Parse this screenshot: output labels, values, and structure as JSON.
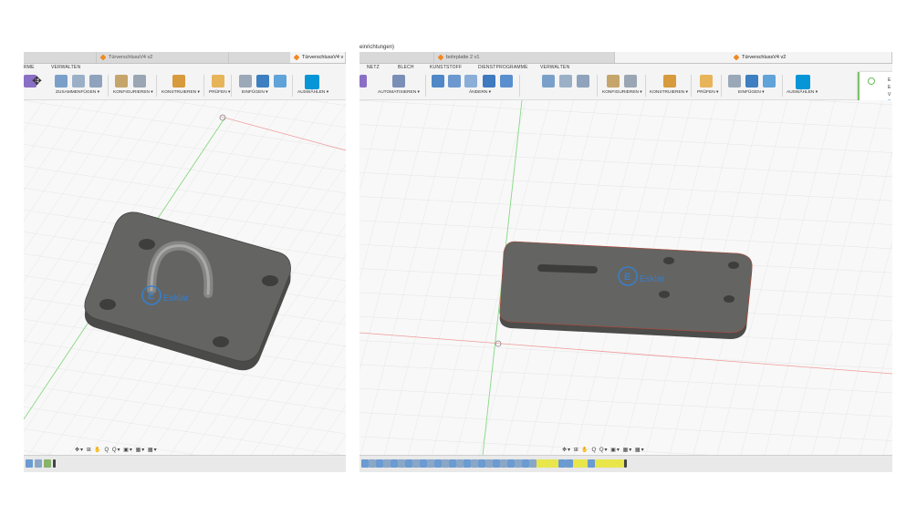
{
  "left": {
    "tabs": {
      "second": "TürverschlussV4 v2",
      "third": "TürverschlussV4 v"
    },
    "menus": {
      "first": "RME",
      "verwalten": "VERWALTEN"
    },
    "groups": {
      "assemble": "ZUSAMMENFÜGEN ▾",
      "configure": "KONFIGURIEREN ▾",
      "construct": "KONSTRUIEREN ▾",
      "inspect": "PRÜFEN ▾",
      "insert": "EINFÜGEN ▾",
      "select": "AUSWÄHLEN ▾"
    },
    "navbar": "✥▾ ⊞ ✋ Q Q▾ ▣▾ ▦▾ ▦▾",
    "logo_text": "Esklar"
  },
  "right": {
    "titlebar": "einrichtungen)",
    "tabs": {
      "second": "bohrplatte 2 v1",
      "third": "TürverschlussV4 v2"
    },
    "menus": {
      "netz": "NETZ",
      "blech": "BLECH",
      "kunststoff": "KUNSTSTOFF",
      "dienstprogramme": "DIENSTPROGRAMME",
      "verwalten": "VERWALTEN"
    },
    "groups": {
      "automate": "AUTOMATISIEREN ▾",
      "modify": "ÄNDERN ▾",
      "configure": "KONFIGURIEREN ▾",
      "construct": "KONSTRUIEREN ▾",
      "inspect": "PRÜFEN ▾",
      "insert": "EINFÜGEN ▾",
      "select": "AUSWÄHLEN ▾"
    },
    "notification": {
      "line1": "E",
      "line2": "E",
      "line3": "V",
      "link": "S"
    },
    "navbar": "✥▾ ⊞ ✋ Q Q▾ ▣▾ ▦▾ ▦▾",
    "logo_text": "Esklar"
  },
  "colors": {
    "part": "#5d5d5b",
    "logo": "#3a7ec6",
    "accent": "#0696d7",
    "grid": "#dedede"
  }
}
